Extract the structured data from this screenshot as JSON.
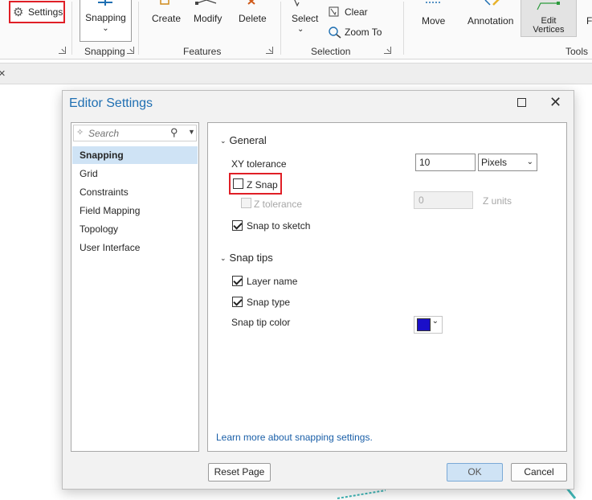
{
  "ribbon": {
    "settings_label": "Settings",
    "snapping_button_label": "Snapping",
    "snapping_group_label": "Snapping",
    "create_label": "Create",
    "modify_label": "Modify",
    "delete_label": "Delete",
    "features_group_label": "Features",
    "select_label": "Select",
    "clear_label": "Clear",
    "zoom_to_label": "Zoom To",
    "selection_group_label": "Selection",
    "move_label": "Move",
    "annotation_label": "Annotation",
    "edit_vertices_line1": "Edit",
    "edit_vertices_line2": "Vertices",
    "tools_group_label": "Tools",
    "truncated_label": "F"
  },
  "tab": {
    "close_glyph": "×"
  },
  "dialog": {
    "title": "Editor Settings",
    "close_glyph": "✕",
    "search_placeholder": "Search",
    "nav_items": [
      "Snapping",
      "Grid",
      "Constraints",
      "Field Mapping",
      "Topology",
      "User Interface"
    ],
    "general_header": "General",
    "xy_tolerance_label": "XY tolerance",
    "xy_tolerance_value": "10",
    "xy_tolerance_units": "Pixels",
    "z_snap_label": "Z Snap",
    "z_tolerance_label": "Z tolerance",
    "z_tolerance_value": "0",
    "z_units_label": "Z units",
    "snap_to_sketch_label": "Snap to sketch",
    "snap_tips_header": "Snap tips",
    "layer_name_label": "Layer name",
    "snap_type_label": "Snap type",
    "snap_tip_color_label": "Snap tip color",
    "snap_tip_color": "#1a0fc9",
    "learn_more_link": "Learn more about snapping settings.",
    "reset_button": "Reset Page",
    "ok_button": "OK",
    "cancel_button": "Cancel",
    "checkbox_states": {
      "z_snap": false,
      "z_tolerance": false,
      "snap_to_sketch": true,
      "layer_name": true,
      "snap_type": true
    }
  },
  "colors": {
    "accent": "#1f6fb2",
    "highlight": "#e01f26",
    "selected_nav": "#cfe3f5"
  }
}
